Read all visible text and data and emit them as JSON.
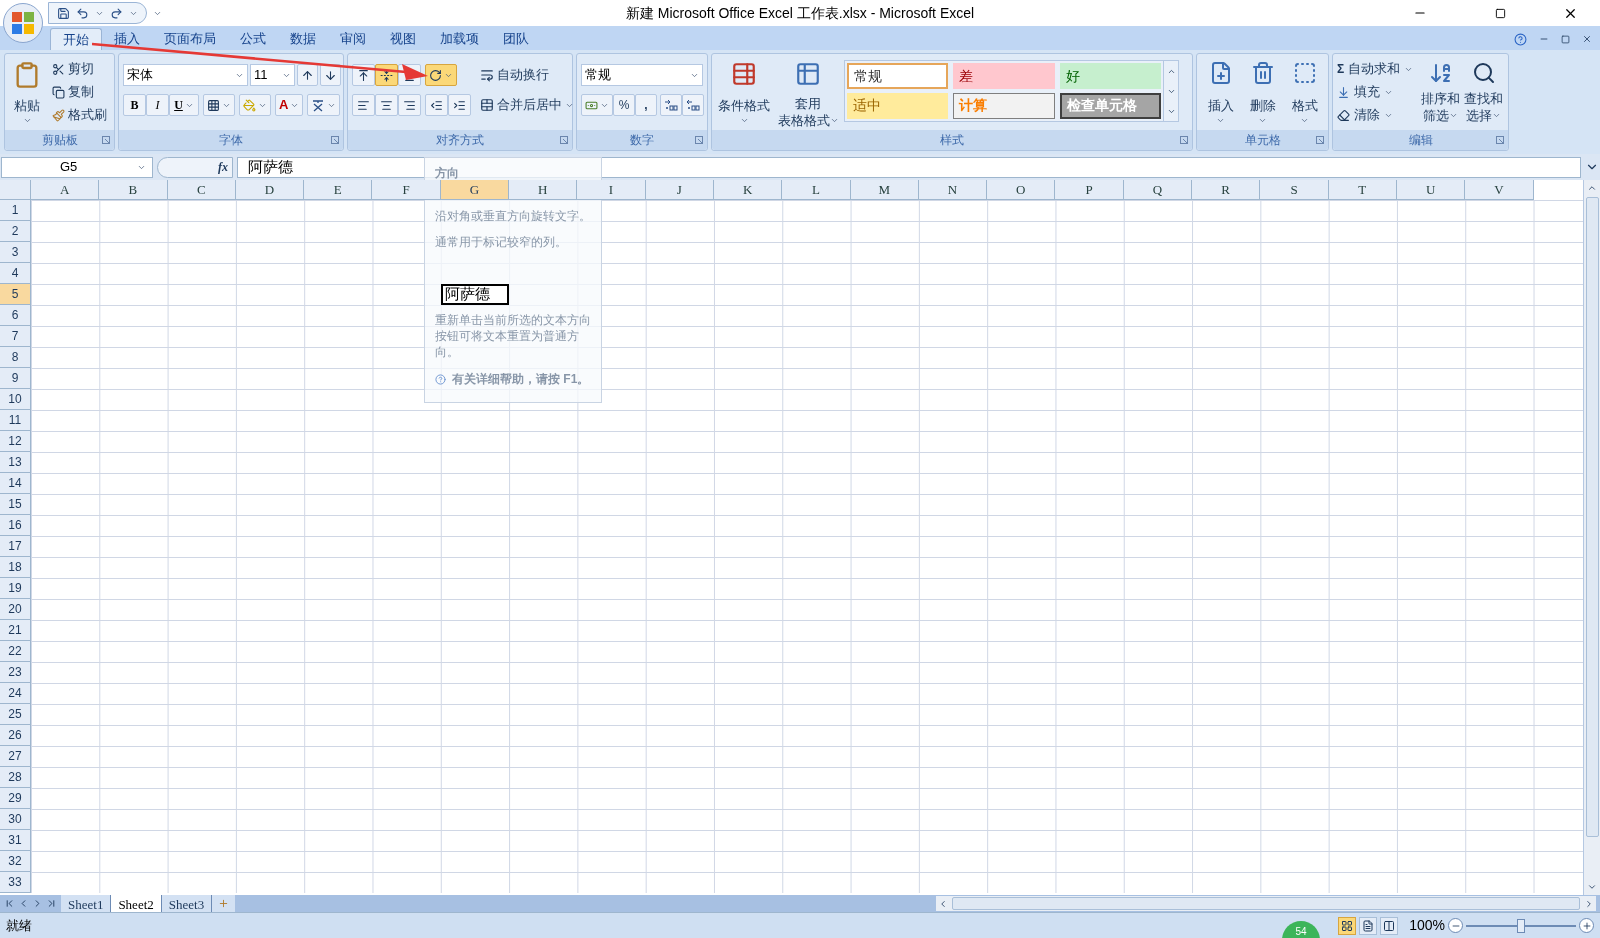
{
  "window": {
    "title": "新建 Microsoft Office Excel 工作表.xlsx - Microsoft Excel"
  },
  "ribbon_tabs": [
    {
      "label": "开始",
      "selected": true
    },
    {
      "label": "插入",
      "selected": false
    },
    {
      "label": "页面布局",
      "selected": false
    },
    {
      "label": "公式",
      "selected": false
    },
    {
      "label": "数据",
      "selected": false
    },
    {
      "label": "审阅",
      "selected": false
    },
    {
      "label": "视图",
      "selected": false
    },
    {
      "label": "加载项",
      "selected": false
    },
    {
      "label": "团队",
      "selected": false
    }
  ],
  "clipboard": {
    "paste": "粘贴",
    "cut": "剪切",
    "copy": "复制",
    "format_painter": "格式刷",
    "group": "剪贴板"
  },
  "font": {
    "name": "宋体",
    "size": "11",
    "bold": "B",
    "italic": "I",
    "underline": "U",
    "font_color": "A",
    "group": "字体"
  },
  "alignment": {
    "vertical": [
      {
        "kind": "top",
        "selected": false
      },
      {
        "kind": "middle",
        "selected": true
      },
      {
        "kind": "bottom",
        "selected": false
      },
      {
        "kind": "orientation",
        "selected": true
      }
    ],
    "wrap": "自动换行",
    "merge": "合并后居中",
    "group": "对齐方式"
  },
  "number": {
    "format": "常规",
    "percent": "%",
    "comma": ",",
    "group": "数字"
  },
  "styles": {
    "conditional": "条件格式",
    "table_top": "套用",
    "table_bottom": "表格格式",
    "group": "样式",
    "cells": [
      {
        "label": "常规",
        "kind": "normal"
      },
      {
        "label": "差",
        "kind": "bad"
      },
      {
        "label": "好",
        "kind": "good"
      },
      {
        "label": "适中",
        "kind": "neutral"
      },
      {
        "label": "计算",
        "kind": "calculation"
      },
      {
        "label": "检查单元格",
        "kind": "check"
      }
    ]
  },
  "cells_group": {
    "insert": "插入",
    "delete": "删除",
    "format": "格式",
    "group": "单元格"
  },
  "editing": {
    "autosum_symbol": "Σ",
    "autosum": "自动求和",
    "fill": "填充",
    "clear": "清除",
    "sort_top": "排序和",
    "sort_bottom": "筛选",
    "find_top": "查找和",
    "find_bottom": "选择",
    "group": "编辑"
  },
  "formula_bar": {
    "name_box": "G5",
    "fx": "fx",
    "value": "阿萨德"
  },
  "columns": [
    {
      "label": "A",
      "selected": false
    },
    {
      "label": "B",
      "selected": false
    },
    {
      "label": "C",
      "selected": false
    },
    {
      "label": "D",
      "selected": false
    },
    {
      "label": "E",
      "selected": false
    },
    {
      "label": "F",
      "selected": false
    },
    {
      "label": "G",
      "selected": true
    },
    {
      "label": "H",
      "selected": false
    },
    {
      "label": "I",
      "selected": false
    },
    {
      "label": "J",
      "selected": false
    },
    {
      "label": "K",
      "selected": false
    },
    {
      "label": "L",
      "selected": false
    },
    {
      "label": "M",
      "selected": false
    },
    {
      "label": "N",
      "selected": false
    },
    {
      "label": "O",
      "selected": false
    },
    {
      "label": "P",
      "selected": false
    },
    {
      "label": "Q",
      "selected": false
    },
    {
      "label": "R",
      "selected": false
    },
    {
      "label": "S",
      "selected": false
    },
    {
      "label": "T",
      "selected": false
    },
    {
      "label": "U",
      "selected": false
    },
    {
      "label": "V",
      "selected": false
    }
  ],
  "rows": [
    {
      "label": "1",
      "selected": false
    },
    {
      "label": "2",
      "selected": false
    },
    {
      "label": "3",
      "selected": false
    },
    {
      "label": "4",
      "selected": false
    },
    {
      "label": "5",
      "selected": true
    },
    {
      "label": "6",
      "selected": false
    },
    {
      "label": "7",
      "selected": false
    },
    {
      "label": "8",
      "selected": false
    },
    {
      "label": "9",
      "selected": false
    },
    {
      "label": "10",
      "selected": false
    },
    {
      "label": "11",
      "selected": false
    },
    {
      "label": "12",
      "selected": false
    },
    {
      "label": "13",
      "selected": false
    },
    {
      "label": "14",
      "selected": false
    },
    {
      "label": "15",
      "selected": false
    },
    {
      "label": "16",
      "selected": false
    },
    {
      "label": "17",
      "selected": false
    },
    {
      "label": "18",
      "selected": false
    },
    {
      "label": "19",
      "selected": false
    },
    {
      "label": "20",
      "selected": false
    },
    {
      "label": "21",
      "selected": false
    },
    {
      "label": "22",
      "selected": false
    },
    {
      "label": "23",
      "selected": false
    },
    {
      "label": "24",
      "selected": false
    },
    {
      "label": "25",
      "selected": false
    },
    {
      "label": "26",
      "selected": false
    },
    {
      "label": "27",
      "selected": false
    },
    {
      "label": "28",
      "selected": false
    },
    {
      "label": "29",
      "selected": false
    },
    {
      "label": "30",
      "selected": false
    },
    {
      "label": "31",
      "selected": false
    },
    {
      "label": "32",
      "selected": false
    },
    {
      "label": "33",
      "selected": false
    }
  ],
  "selected_cell": {
    "value": "阿萨德"
  },
  "tooltip": {
    "title": "方向",
    "paragraphs": [
      "沿对角或垂直方向旋转文字。",
      "通常用于标记较窄的列。",
      "重新单击当前所选的文本方向按钮可将文本重置为普通方向。"
    ],
    "help": "有关详细帮助，请按 F1。"
  },
  "sheet_tabs": [
    {
      "label": "Sheet1",
      "selected": false
    },
    {
      "label": "Sheet2",
      "selected": true
    },
    {
      "label": "Sheet3",
      "selected": false
    }
  ],
  "status_bar": {
    "text": "就绪",
    "badge": "54",
    "views": [
      {
        "kind": "normal",
        "selected": true
      },
      {
        "kind": "layout",
        "selected": false
      },
      {
        "kind": "page_break",
        "selected": false
      }
    ],
    "zoom": "100%",
    "zoom_level": {
      "level": 0.5
    }
  }
}
